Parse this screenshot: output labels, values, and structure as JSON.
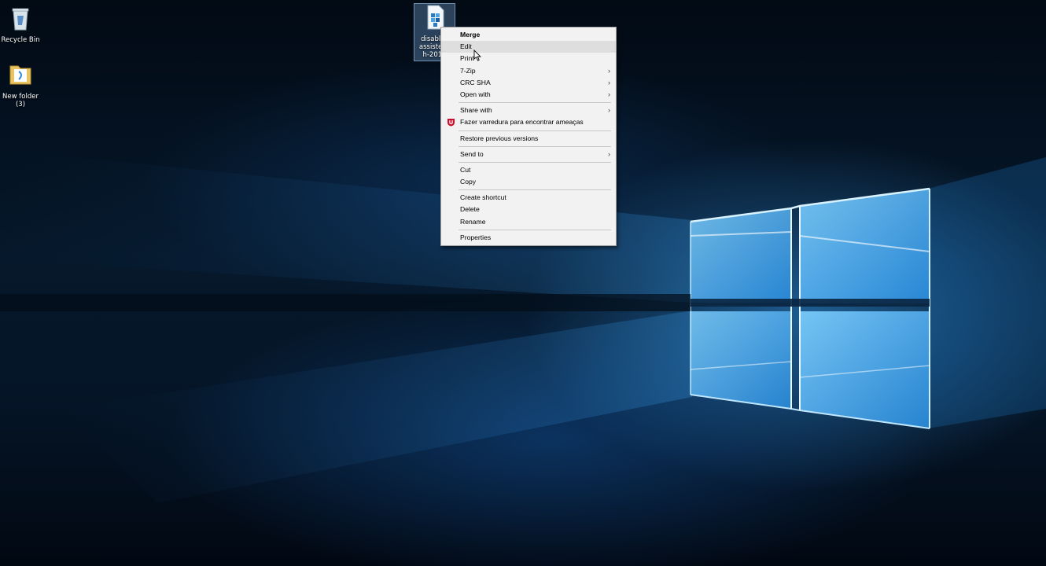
{
  "desktop": {
    "icons": [
      {
        "label": "Recycle Bin",
        "icon": "recycle-bin-icon"
      },
      {
        "label": "New folder\n(3)",
        "icon": "folder-icon"
      },
      {
        "label_lines": [
          "disables",
          "assisteds",
          "h-2016"
        ],
        "icon": "registry-file-icon",
        "selected": true
      }
    ]
  },
  "context_menu": {
    "items": [
      {
        "label": "Merge",
        "bold": true
      },
      {
        "label": "Edit",
        "hover": true
      },
      {
        "label": "Print"
      },
      {
        "label": "7-Zip",
        "submenu": true
      },
      {
        "label": "CRC SHA",
        "submenu": true
      },
      {
        "label": "Open with",
        "submenu": true
      },
      {
        "separator": true
      },
      {
        "label": "Share with",
        "submenu": true
      },
      {
        "label": "Fazer varredura para encontrar ameaças",
        "icon": "mcafee-shield-icon"
      },
      {
        "separator": true
      },
      {
        "label": "Restore previous versions"
      },
      {
        "separator": true
      },
      {
        "label": "Send to",
        "submenu": true
      },
      {
        "separator": true
      },
      {
        "label": "Cut"
      },
      {
        "label": "Copy"
      },
      {
        "separator": true
      },
      {
        "label": "Create shortcut"
      },
      {
        "label": "Delete"
      },
      {
        "label": "Rename"
      },
      {
        "separator": true
      },
      {
        "label": "Properties"
      }
    ],
    "submenu_arrow": "›"
  },
  "colors": {
    "menu_bg": "#f2f2f2",
    "menu_hover": "#dedede",
    "wallpaper_glow": "#3aa0e8",
    "mcafee_red": "#c8102e"
  }
}
